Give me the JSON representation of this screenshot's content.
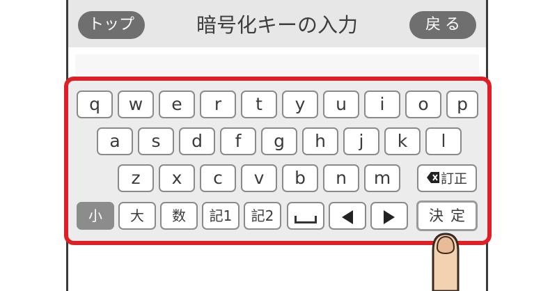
{
  "header": {
    "top_button": "トップ",
    "title": "暗号化キーの入力",
    "back_button": "戻る"
  },
  "input": {
    "value": ""
  },
  "keyboard": {
    "row1": [
      "q",
      "w",
      "e",
      "r",
      "t",
      "y",
      "u",
      "i",
      "o",
      "p"
    ],
    "row2": [
      "a",
      "s",
      "d",
      "f",
      "g",
      "h",
      "j",
      "k",
      "l"
    ],
    "row3": [
      "z",
      "x",
      "c",
      "v",
      "b",
      "n",
      "m"
    ],
    "backspace": "訂正",
    "bottom": {
      "small": "小",
      "large": "大",
      "number": "数",
      "symbol1": "記1",
      "symbol2": "記2",
      "space": "space-icon",
      "left": "left-arrow-icon",
      "right": "right-arrow-icon",
      "decide": "決定"
    }
  },
  "colors": {
    "highlight_border": "#e01e26",
    "header_button": "#6f6f6f",
    "active_key": "#8c8c8c",
    "finger_skin": "#f2d2b0"
  }
}
